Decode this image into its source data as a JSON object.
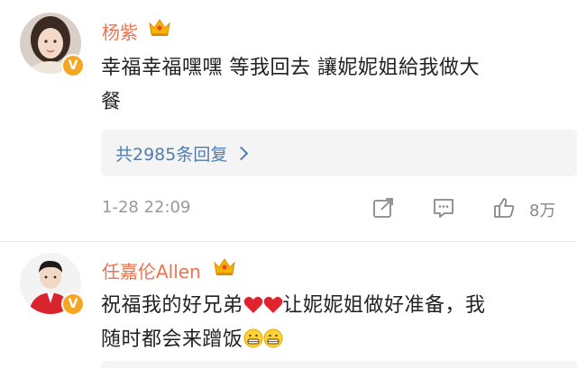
{
  "comments": [
    {
      "username": "杨紫",
      "text_line1": "幸福幸福嘿嘿 等我回去 讓妮妮姐給我做大",
      "text_line2": "餐",
      "replies_label": "共2985条回复",
      "timestamp": "1-28 22:09",
      "like_count": "8万",
      "avatar_icon": "avatar-woman",
      "verified_icon": "verified-v-badge",
      "crown_icon": "crown-badge"
    },
    {
      "username": "任嘉伦Allen",
      "text_part1": "祝福我的好兄弟",
      "text_part2": "让妮妮姐做好准备，我",
      "text_line2": "随时都会来蹭饭",
      "heart_emoji": "red-heart",
      "grin_emoji": "grinning-face",
      "avatar_icon": "avatar-man-red-suit",
      "verified_icon": "verified-v-badge",
      "crown_icon": "crown-badge"
    }
  ],
  "colors": {
    "username": "#eb7350",
    "link": "#507daf",
    "meta": "#999999",
    "badge": "#f5a623"
  }
}
